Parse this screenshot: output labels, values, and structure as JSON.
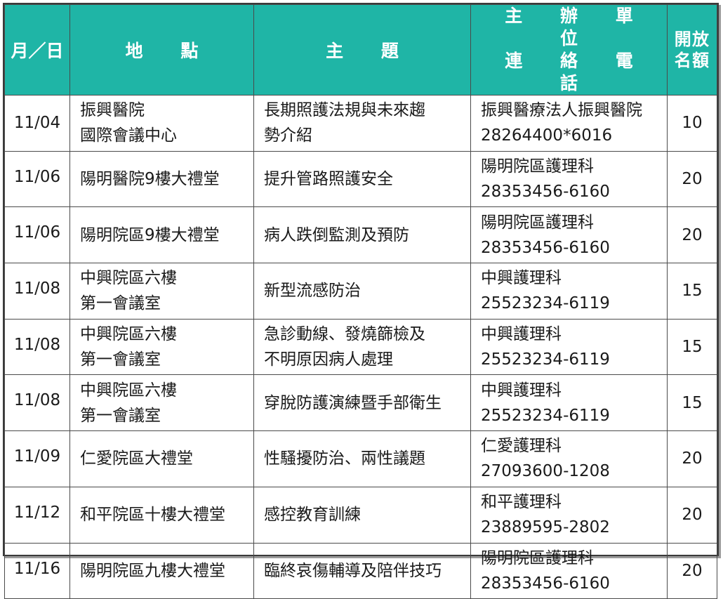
{
  "header": {
    "date": "月／日",
    "location": "地 點",
    "topic": "主 題",
    "organizer_l1": "主 辦 單 位",
    "organizer_l2": "連 絡 電 話",
    "quota_l1": "開放",
    "quota_l2": "名額"
  },
  "rows": [
    {
      "date": "11/04",
      "loc1": "振興醫院",
      "loc2": "國際會議中心",
      "topic1": "長期照護法規與未來趨",
      "topic2": "勢介紹",
      "org": "振興醫療法人振興醫院",
      "phone": "28264400*6016",
      "quota": "10"
    },
    {
      "date": "11/06",
      "loc1": "陽明醫院9樓大禮堂",
      "loc2": "",
      "topic1": "提升管路照護安全",
      "topic2": "",
      "org": "陽明院區護理科",
      "phone": "28353456-6160",
      "quota": "20"
    },
    {
      "date": "11/06",
      "loc1": "陽明院區9樓大禮堂",
      "loc2": "",
      "topic1": "病人跌倒監測及預防",
      "topic2": "",
      "org": "陽明院區護理科",
      "phone": "28353456-6160",
      "quota": "20"
    },
    {
      "date": "11/08",
      "loc1": "中興院區六樓",
      "loc2": "第一會議室",
      "topic1": "新型流感防治",
      "topic2": "",
      "org": "中興護理科",
      "phone": "25523234-6119",
      "quota": "15"
    },
    {
      "date": "11/08",
      "loc1": "中興院區六樓",
      "loc2": "第一會議室",
      "topic1": "急診動線、發燒篩檢及",
      "topic2": "不明原因病人處理",
      "org": "中興護理科",
      "phone": "25523234-6119",
      "quota": "15"
    },
    {
      "date": "11/08",
      "loc1": "中興院區六樓",
      "loc2": "第一會議室",
      "topic1": "穿脫防護演練暨手部衛生",
      "topic2": "",
      "org": "中興護理科",
      "phone": "25523234-6119",
      "quota": "15"
    },
    {
      "date": "11/09",
      "loc1": "仁愛院區大禮堂",
      "loc2": "",
      "topic1": "性騷擾防治、兩性議題",
      "topic2": "",
      "org": "仁愛護理科",
      "phone": "27093600-1208",
      "quota": "20"
    },
    {
      "date": "11/12",
      "loc1": "和平院區十樓大禮堂",
      "loc2": "",
      "topic1": "感控教育訓練",
      "topic2": "",
      "org": "和平護理科",
      "phone": "23889595-2802",
      "quota": "20"
    },
    {
      "date": "11/16",
      "loc1": "陽明院區九樓大禮堂",
      "loc2": "",
      "topic1": "臨終哀傷輔導及陪伴技巧",
      "topic2": "",
      "org": "陽明院區護理科",
      "phone": "28353456-6160",
      "quota": "20"
    }
  ]
}
